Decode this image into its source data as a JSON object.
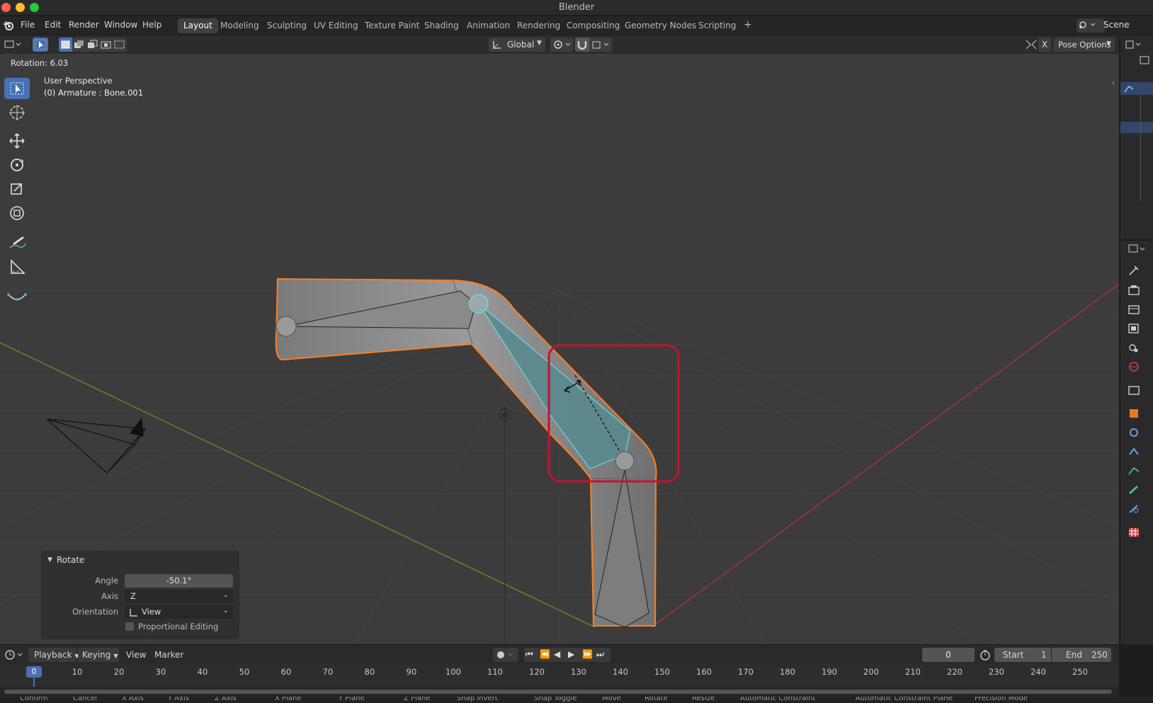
{
  "app": {
    "title": "Blender"
  },
  "menu": [
    "File",
    "Edit",
    "Render",
    "Window",
    "Help"
  ],
  "workspaces": [
    "Layout",
    "Modeling",
    "Sculpting",
    "UV Editing",
    "Texture Paint",
    "Shading",
    "Animation",
    "Rendering",
    "Compositing",
    "Geometry Nodes",
    "Scripting"
  ],
  "active_workspace": "Layout",
  "scene": {
    "label": "Scene"
  },
  "header": {
    "orientation": "Global",
    "pose_options": "Pose Options",
    "x_mirror": "X"
  },
  "viewport": {
    "rotation_readout": "Rotation: 6.03",
    "perspective": "User Perspective",
    "object": "(0) Armature : Bone.001"
  },
  "rotate_panel": {
    "title": "Rotate",
    "angle_label": "Angle",
    "angle_value": "-50.1°",
    "axis_label": "Axis",
    "axis_value": "Z",
    "orientation_label": "Orientation",
    "orientation_value": "View",
    "proportional_label": "Proportional Editing",
    "proportional_checked": false
  },
  "timeline": {
    "menus": [
      "Playback",
      "Keying",
      "View",
      "Marker"
    ],
    "current_frame": "0",
    "start_label": "Start",
    "start_value": "1",
    "end_label": "End",
    "end_value": "250",
    "ticks": [
      "0",
      "10",
      "20",
      "30",
      "40",
      "50",
      "60",
      "70",
      "80",
      "90",
      "100",
      "110",
      "120",
      "130",
      "140",
      "150",
      "160",
      "170",
      "180",
      "190",
      "200",
      "210",
      "220",
      "230",
      "240",
      "250"
    ],
    "playhead_frame": 0
  },
  "status": {
    "items": [
      "Confirm",
      "Cancel",
      "X Axis",
      "Y Axis",
      "Z Axis",
      "X Plane",
      "Y Plane",
      "Z Plane",
      "Snap Invert",
      "Snap Toggle",
      "Move",
      "Rotate",
      "Resize",
      "Automatic Constraint",
      "Automatic Constraint Plane",
      "Precision Mode"
    ]
  },
  "colors": {
    "selection_outline": "#ff7f1e",
    "active_bone": "#5fa7ae",
    "highlight_box": "#c8102e",
    "x_axis": "#b5323b",
    "y_axis": "#6a8f1d",
    "accent": "#4772b3"
  }
}
